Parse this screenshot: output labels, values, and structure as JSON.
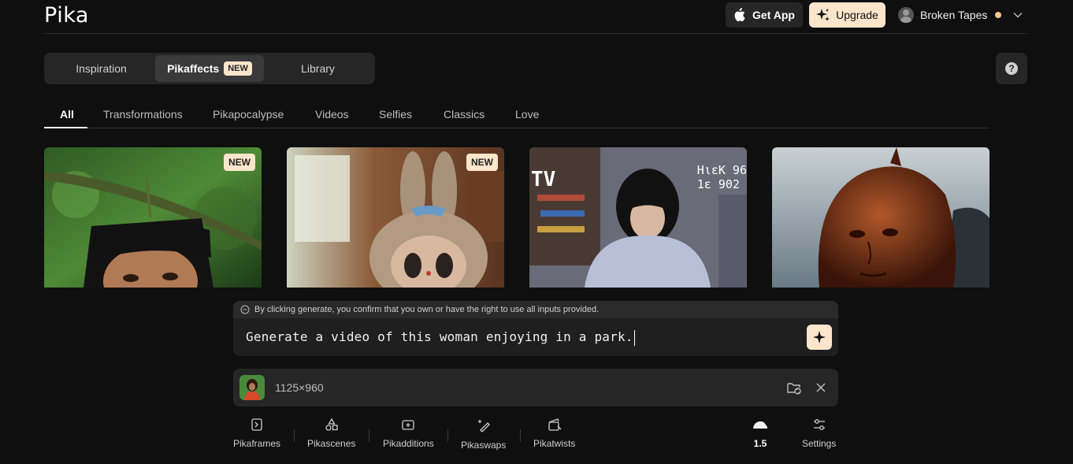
{
  "header": {
    "logo": "Pika",
    "get_app": "Get App",
    "upgrade": "Upgrade",
    "username": "Broken Tapes"
  },
  "main_tabs": [
    {
      "label": "Inspiration"
    },
    {
      "label": "Pikaffects",
      "badge": "NEW"
    },
    {
      "label": "Library"
    }
  ],
  "help": "?",
  "categories": [
    "All",
    "Transformations",
    "Pikapocalypse",
    "Videos",
    "Selfies",
    "Classics",
    "Love"
  ],
  "cards": [
    {
      "badge": "NEW",
      "overlay": ""
    },
    {
      "badge": "NEW",
      "overlay": ""
    },
    {
      "badge": "",
      "overlay": "TV"
    },
    {
      "badge": "",
      "overlay": ""
    }
  ],
  "card3_overlay_right": "ΗιεΚ 96\n1ε 902",
  "prompt": {
    "notice": "By clicking generate, you confirm that you own or have the right to use all inputs provided.",
    "text": "Generate a video of this woman enjoying in a park."
  },
  "attachment": {
    "dimensions": "1125×960"
  },
  "toolbar": {
    "pikaframes": "Pikaframes",
    "pikascenes": "Pikascenes",
    "pikadditions": "Pikadditions",
    "pikaswaps": "Pikaswaps",
    "pikatwists": "Pikatwists",
    "model": "1.5",
    "settings": "Settings"
  },
  "colors": {
    "accent": "#fbe6cc",
    "background": "#0f0f0f",
    "panel": "#262626",
    "status_dot": "#f6c98a"
  }
}
